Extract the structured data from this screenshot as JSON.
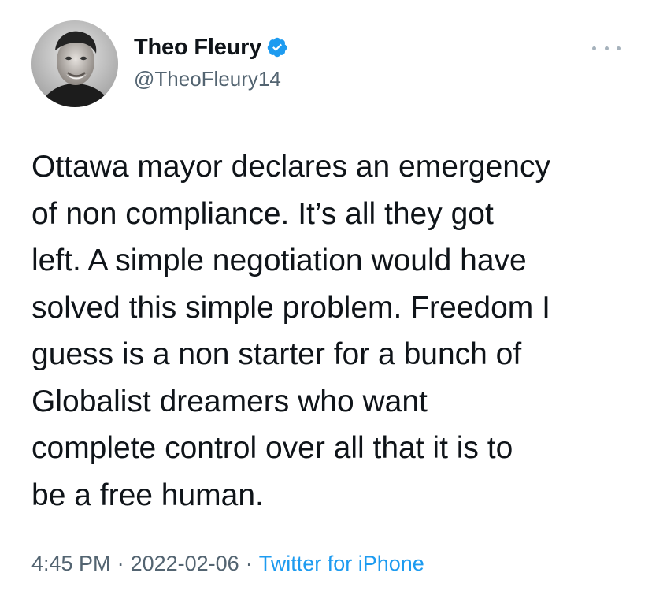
{
  "author": {
    "display_name": "Theo Fleury",
    "handle": "@TheoFleury14",
    "verified": true
  },
  "tweet": {
    "text": "Ottawa mayor declares an emergency\nof non compliance. It’s all they got\nleft. A simple negotiation would have\nsolved this simple problem. Freedom I\nguess is a non starter for a bunch of\nGlobalist dreamers who want\ncomplete control over all that it is to\nbe a free human.",
    "time": "4:45 PM",
    "date": "2022-02-06",
    "separator": "·",
    "source": "Twitter for iPhone"
  },
  "colors": {
    "verified_badge": "#1d9bf0",
    "source_link": "#1d9bf0",
    "secondary_text": "#536471",
    "primary_text": "#0f1419"
  },
  "icons": {
    "verified": "verified-badge-icon",
    "more": "more-options-icon"
  }
}
